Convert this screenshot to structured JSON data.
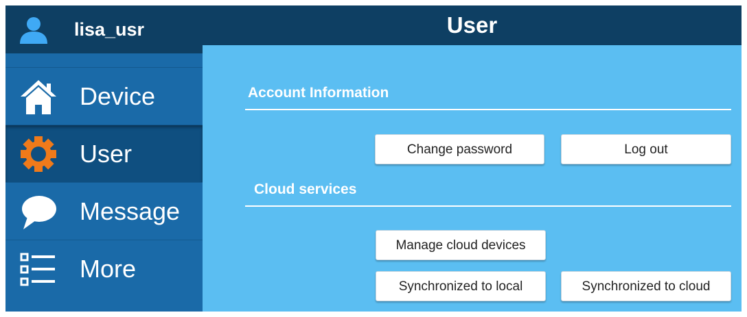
{
  "user": {
    "name": "lisa_usr",
    "icon": "user-icon"
  },
  "sidebar": {
    "items": [
      {
        "label": "Device",
        "icon": "home-icon"
      },
      {
        "label": "User",
        "icon": "gear-icon",
        "active": true
      },
      {
        "label": "Message",
        "icon": "speech-bubble-icon"
      },
      {
        "label": "More",
        "icon": "list-icon"
      }
    ]
  },
  "header": {
    "title": "User"
  },
  "sections": {
    "account": {
      "title": "Account Information",
      "change_password_label": "Change password",
      "logout_label": "Log out"
    },
    "cloud": {
      "title": "Cloud services",
      "manage_devices_label": "Manage cloud devices",
      "sync_local_label": "Synchronized to local",
      "sync_cloud_label": "Synchronized to cloud"
    }
  },
  "colors": {
    "sidebar_bg": "#1a6aa8",
    "header_bg": "#0e3f63",
    "active_item_bg": "#0f4f80",
    "main_bg": "#5bbef2",
    "user_icon": "#3fa9f5",
    "gear_icon": "#f07a1a",
    "button_bg": "#ffffff"
  }
}
